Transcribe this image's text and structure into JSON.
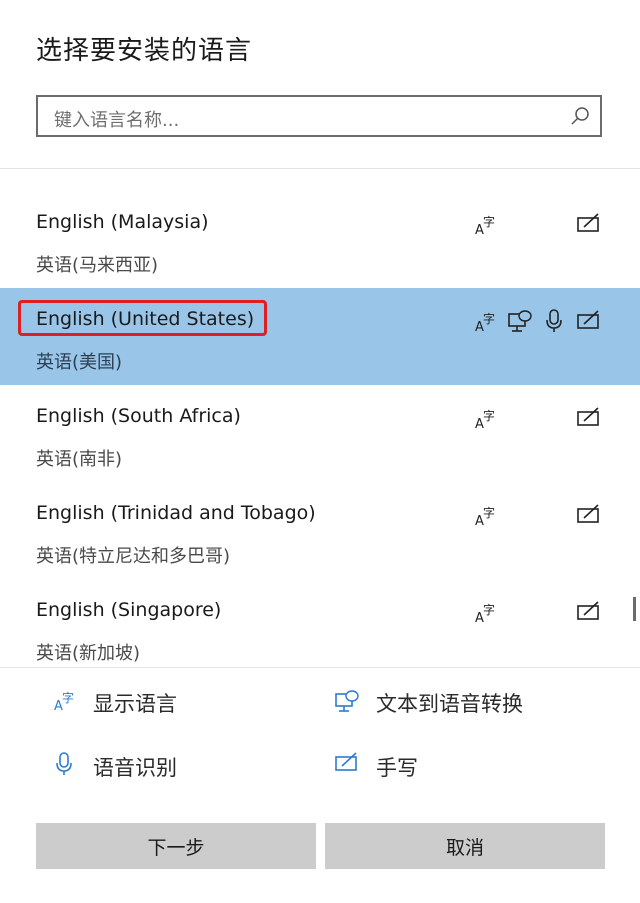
{
  "dialog": {
    "title": "选择要安装的语言"
  },
  "search": {
    "placeholder": "键入语言名称..."
  },
  "languages": [
    {
      "name": "English (Malaysia)",
      "native": "英语(马来西亚)",
      "features": [
        "display-language",
        "handwriting"
      ],
      "selected": false
    },
    {
      "name": "English (United States)",
      "native": "英语(美国)",
      "features": [
        "display-language",
        "text-to-speech",
        "speech-recognition",
        "handwriting"
      ],
      "selected": true
    },
    {
      "name": "English (South Africa)",
      "native": "英语(南非)",
      "features": [
        "display-language",
        "handwriting"
      ],
      "selected": false
    },
    {
      "name": "English (Trinidad and Tobago)",
      "native": "英语(特立尼达和多巴哥)",
      "features": [
        "display-language",
        "handwriting"
      ],
      "selected": false
    },
    {
      "name": "English (Singapore)",
      "native": "英语(新加坡)",
      "features": [
        "display-language",
        "handwriting"
      ],
      "selected": false
    }
  ],
  "legend": {
    "display_language": "显示语言",
    "text_to_speech": "文本到语音转换",
    "speech_recognition": "语音识别",
    "handwriting": "手写"
  },
  "buttons": {
    "next": "下一步",
    "cancel": "取消"
  },
  "colors": {
    "selected_row": "#99c5e8",
    "highlight_border": "#e02020",
    "legend_icon": "#2b7bd0",
    "button_bg": "#cccccc"
  }
}
